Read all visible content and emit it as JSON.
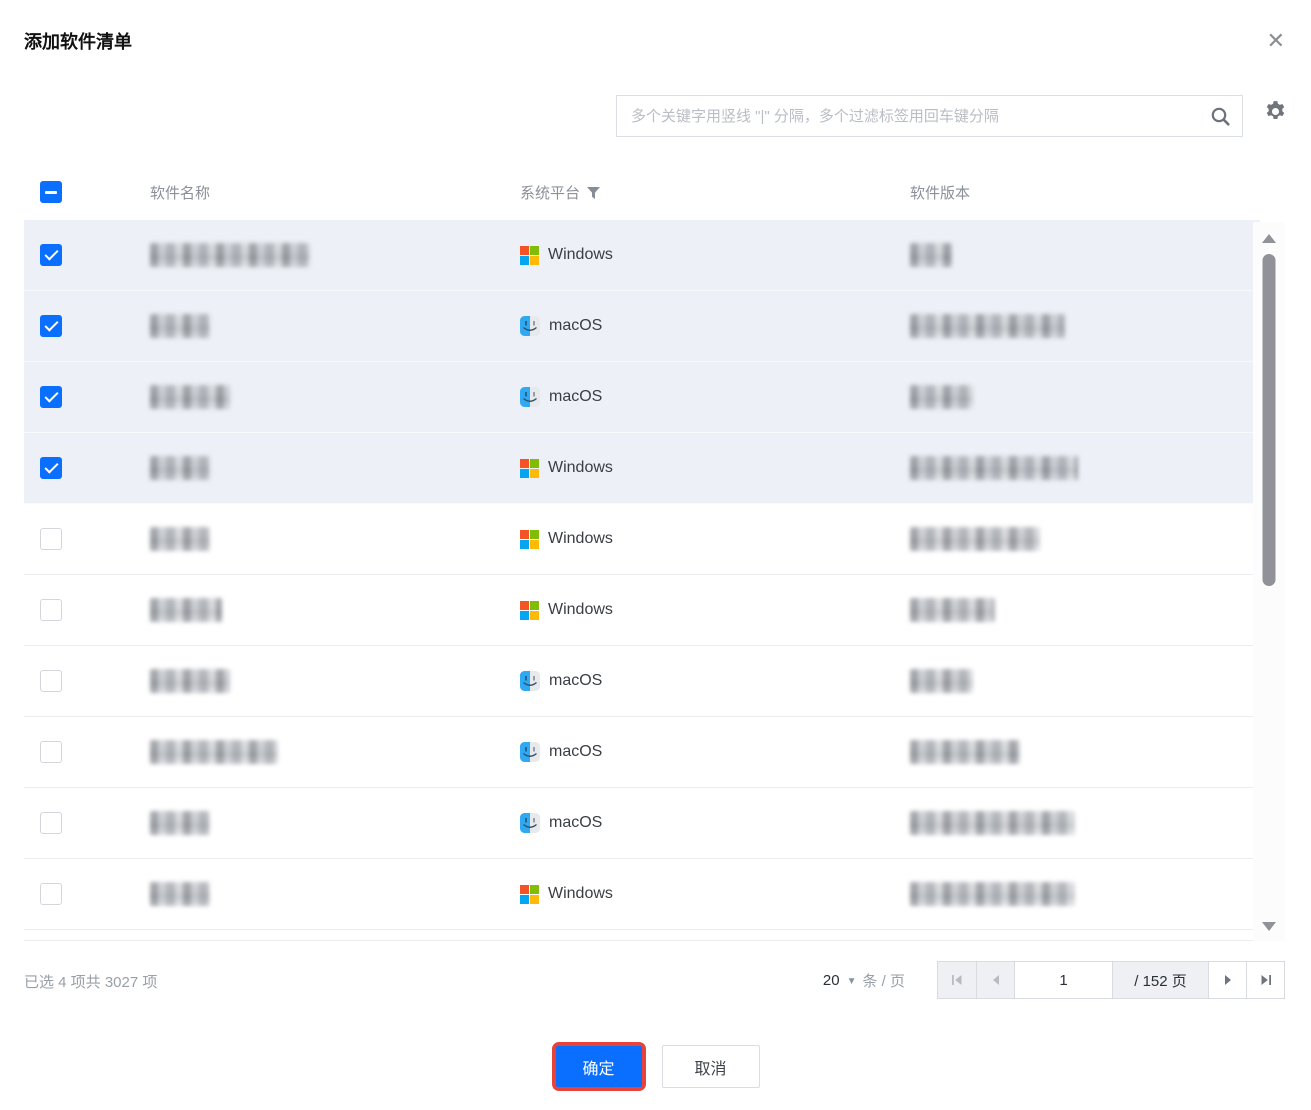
{
  "dialog": {
    "title": "添加软件清单",
    "close_glyph": "✕"
  },
  "search": {
    "placeholder": "多个关键字用竖线 \"|\" 分隔，多个过滤标签用回车键分隔"
  },
  "table": {
    "columns": {
      "name": "软件名称",
      "platform": "系统平台",
      "version": "软件版本"
    },
    "header_checkbox_state": "indeterminate",
    "rows": [
      {
        "selected": true,
        "platform": "Windows",
        "name_redacted_width": 160,
        "version_redacted_width": 42
      },
      {
        "selected": true,
        "platform": "macOS",
        "name_redacted_width": 60,
        "version_redacted_width": 155
      },
      {
        "selected": true,
        "platform": "macOS",
        "name_redacted_width": 80,
        "version_redacted_width": 63
      },
      {
        "selected": true,
        "platform": "Windows",
        "name_redacted_width": 60,
        "version_redacted_width": 168
      },
      {
        "selected": false,
        "platform": "Windows",
        "name_redacted_width": 60,
        "version_redacted_width": 130
      },
      {
        "selected": false,
        "platform": "Windows",
        "name_redacted_width": 72,
        "version_redacted_width": 85
      },
      {
        "selected": false,
        "platform": "macOS",
        "name_redacted_width": 80,
        "version_redacted_width": 63
      },
      {
        "selected": false,
        "platform": "macOS",
        "name_redacted_width": 128,
        "version_redacted_width": 110
      },
      {
        "selected": false,
        "platform": "macOS",
        "name_redacted_width": 60,
        "version_redacted_width": 165
      },
      {
        "selected": false,
        "platform": "Windows",
        "name_redacted_width": 60,
        "version_redacted_width": 165
      }
    ]
  },
  "pagination": {
    "selection_summary": "已选 4 项共 3027 项",
    "page_size": "20",
    "page_size_caret": "▼",
    "page_size_unit": "条 / 页",
    "current_page": "1",
    "total_pages_label": "/ 152 页"
  },
  "actions": {
    "confirm_label": "确定",
    "cancel_label": "取消"
  },
  "colors": {
    "accent_blue": "#0a6eff",
    "annotation_red": "#e5433b",
    "selected_row_bg": "#edf0f6",
    "windows_logo": [
      "#f35325",
      "#81bc06",
      "#05a6f0",
      "#ffba08"
    ],
    "macos_logo_blue": "#2fa9f2"
  },
  "icons": [
    "close-icon",
    "search-icon",
    "gear-icon",
    "filter-funnel-icon",
    "windows-icon",
    "macos-icon",
    "caret-down-icon",
    "page-first-icon",
    "page-prev-icon",
    "page-next-icon",
    "page-last-icon",
    "scrollbar-up-icon",
    "scrollbar-down-icon"
  ]
}
